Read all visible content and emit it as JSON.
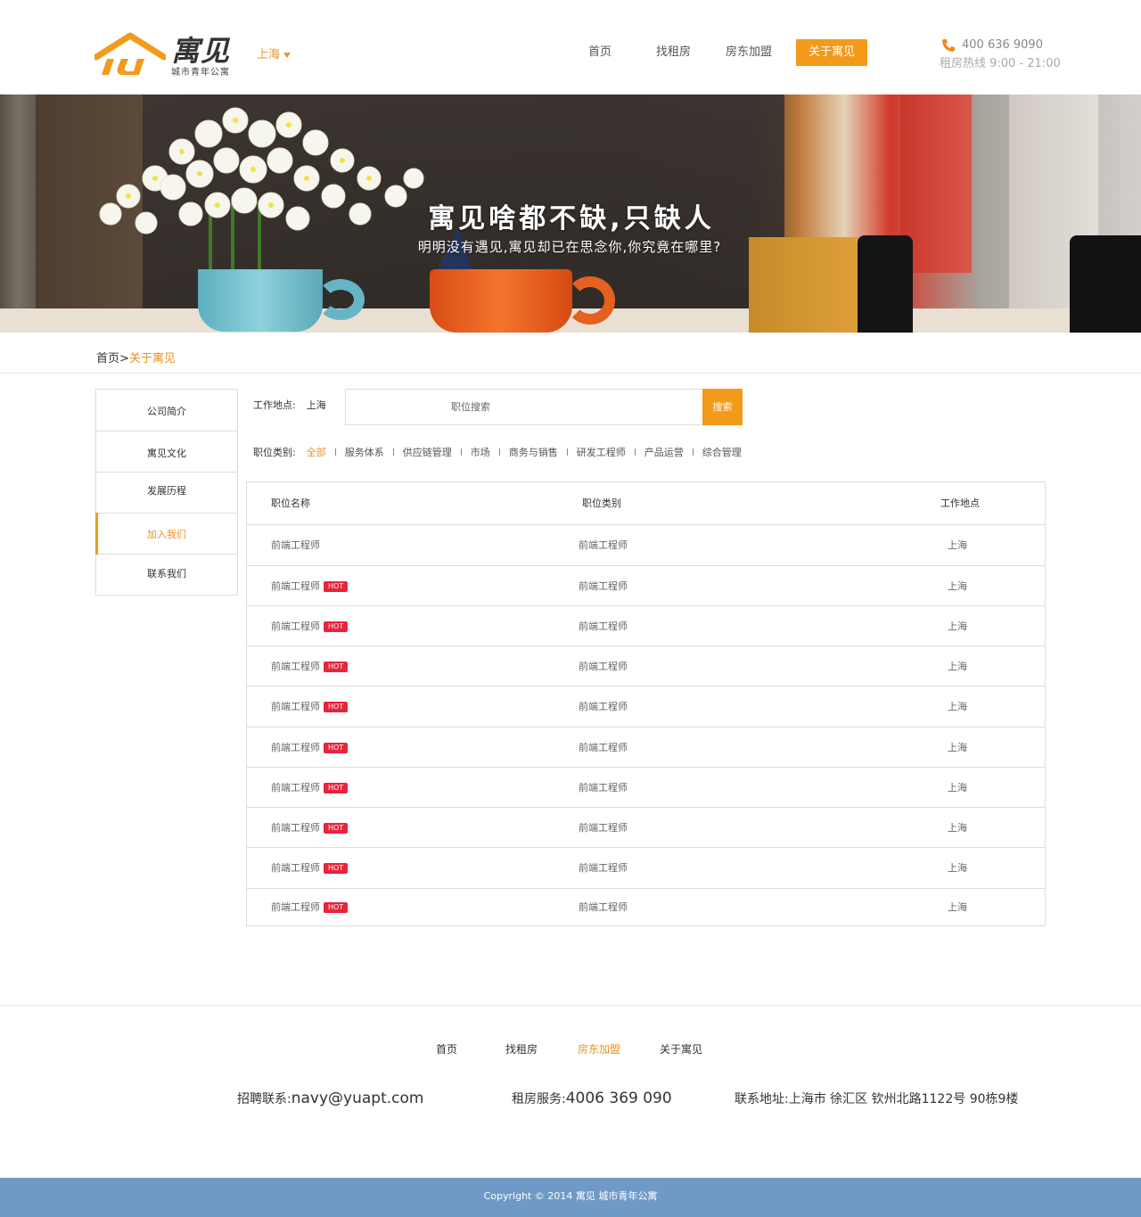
{
  "header": {
    "logo_name": "寓见",
    "logo_sub": "城市青年公寓",
    "city": "上海",
    "nav": [
      {
        "label": "首页"
      },
      {
        "label": "找租房"
      },
      {
        "label": "房东加盟"
      },
      {
        "label": "关于寓见"
      }
    ],
    "active_nav_index": 3,
    "phone": "400 636 9090",
    "hours": "租房热线  9:00 - 21:00"
  },
  "banner": {
    "title": "寓见啥都不缺,只缺人",
    "subtitle": "明明没有遇见,寓见却已在思念你,你究竟在哪里?"
  },
  "breadcrumb": {
    "home": "首页",
    "separator": ">",
    "current": "关于寓见"
  },
  "sidebar": {
    "items": [
      {
        "label": "公司简介"
      },
      {
        "label": "寓见文化"
      },
      {
        "label": "发展历程"
      },
      {
        "label": "加入我们"
      },
      {
        "label": "联系我们"
      }
    ],
    "active_index": 3
  },
  "search": {
    "location_label": "工作地点:",
    "location_value": "上海",
    "placeholder": "职位搜索",
    "button": "搜索"
  },
  "categories": {
    "label": "职位类别:",
    "items": [
      "全部",
      "服务体系",
      "供应链管理",
      "市场",
      "商务与销售",
      "研发工程师",
      "产品运营",
      "综合管理"
    ],
    "active_index": 0
  },
  "jobs": {
    "headers": [
      "职位名称",
      "职位类别",
      "工作地点"
    ],
    "hot_label": "HOT",
    "rows": [
      {
        "name": "前端工程师",
        "category": "前端工程师",
        "location": "上海",
        "hot": false
      },
      {
        "name": "前端工程师",
        "category": "前端工程师",
        "location": "上海",
        "hot": true
      },
      {
        "name": "前端工程师",
        "category": "前端工程师",
        "location": "上海",
        "hot": true
      },
      {
        "name": "前端工程师",
        "category": "前端工程师",
        "location": "上海",
        "hot": true
      },
      {
        "name": "前端工程师",
        "category": "前端工程师",
        "location": "上海",
        "hot": true
      },
      {
        "name": "前端工程师",
        "category": "前端工程师",
        "location": "上海",
        "hot": true
      },
      {
        "name": "前端工程师",
        "category": "前端工程师",
        "location": "上海",
        "hot": true
      },
      {
        "name": "前端工程师",
        "category": "前端工程师",
        "location": "上海",
        "hot": true
      },
      {
        "name": "前端工程师",
        "category": "前端工程师",
        "location": "上海",
        "hot": true
      },
      {
        "name": "前端工程师",
        "category": "前端工程师",
        "location": "上海",
        "hot": true
      }
    ]
  },
  "footer": {
    "nav": [
      {
        "label": "首页"
      },
      {
        "label": "找租房"
      },
      {
        "label": "房东加盟"
      },
      {
        "label": "关于寓见"
      }
    ],
    "active_nav_index": 2,
    "recruit_label": "招聘联系:",
    "recruit_value": "navy@yuapt.com",
    "rent_label": "租房服务:",
    "rent_value": "4006 369 090",
    "address": "联系地址:上海市 徐汇区 钦州北路1122号 90栋9楼",
    "copyright": "Copyright © 2014 寓见 城市青年公寓"
  },
  "colors": {
    "accent": "#f39a1b",
    "hot": "#e8243a",
    "footer_bar": "#6f9ac8"
  }
}
